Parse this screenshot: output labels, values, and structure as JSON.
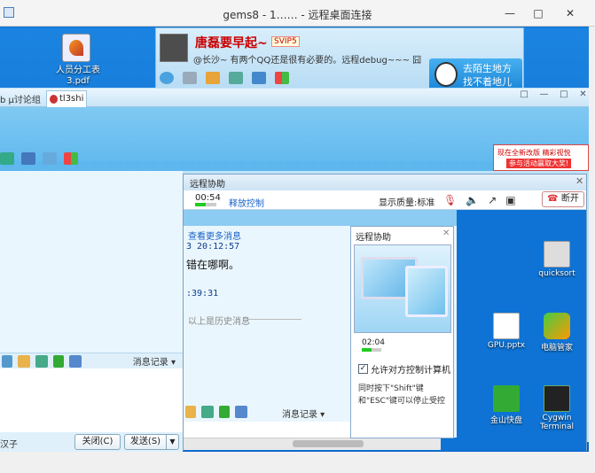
{
  "window": {
    "title": "gems8 - 1…… - 远程桌面连接"
  },
  "desktop": {
    "pdf_icon_label": "人员分工表 3.pdf"
  },
  "qq_panel": {
    "nickname": "唐磊要早起~",
    "vip_badge": "SVIP5",
    "signature": "@长沙~ 有两个QQ还是很有必要的。远程debug~~~ 囧",
    "ad_line1": "去陌生地方",
    "ad_line2": "找不着地儿"
  },
  "chat": {
    "tab_group": "b µ讨论组",
    "tab_active": "tl3shi",
    "ad_line1": "现在全新改版 精彩视悦",
    "ad_line2": "参与活动赢取大奖!",
    "msg_record_label": "消息记录",
    "bottom_label": "汉子",
    "close_label": "关闭(C)",
    "send_label": "发送(S)"
  },
  "remote_assist": {
    "title": "远程协助",
    "timer": "00:54",
    "signal_level": 0.5,
    "release_label": "释放控制",
    "quality_label": "显示质量:标准",
    "hangup_label": "断开"
  },
  "remote_screen": {
    "more_msgs": "查看更多消息",
    "time1": "3 20:12:57",
    "msg1": "错在哪啊。",
    "time2": ":39:31",
    "history_label": "以上是历史消息",
    "msg_record_label": "消息记录",
    "pop": {
      "title": "远程协助",
      "time": "02:04",
      "signal_level": 0.5,
      "allow_label": "允许对方控制计算机",
      "allow_checked": true,
      "hint": "同时按下\"Shift\"键和\"ESC\"键可以停止受控"
    },
    "icons": {
      "quicksort": "quicksort",
      "gpu": "GPU.pptx",
      "pc": "电脑管家",
      "kingsoft": "金山快盘",
      "cygwin": "Cygwin Terminal"
    }
  },
  "colors": {
    "accent_blue": "#1a63c7",
    "desktop_blue": "#0c6fd0",
    "hangup_red": "#d33"
  }
}
